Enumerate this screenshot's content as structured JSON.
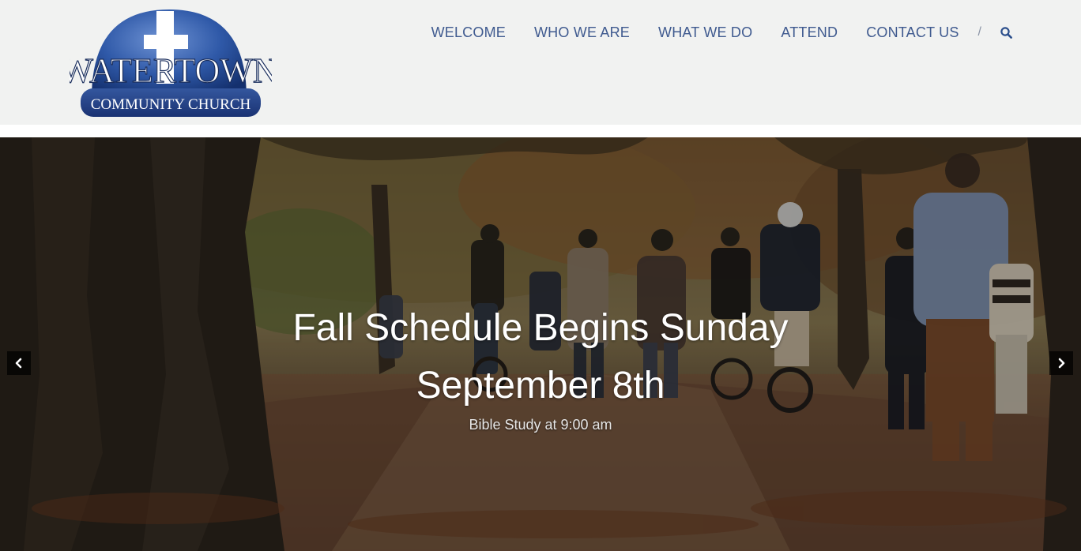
{
  "logo": {
    "name": "WATERTOWN",
    "subtitle": "COMMUNITY CHURCH"
  },
  "nav": {
    "items": [
      "WELCOME",
      "WHO WE ARE",
      "WHAT WE DO",
      "ATTEND",
      "CONTACT US"
    ],
    "separator": "/",
    "search_icon": "search-icon"
  },
  "hero": {
    "title": "Fall Schedule Begins Sunday September 8th",
    "subtitle": "Bible Study at 9:00 am",
    "prev_icon": "chevron-left-icon",
    "next_icon": "chevron-right-icon"
  },
  "colors": {
    "header_bg": "#f1f2f1",
    "nav_text": "#3f5a8f",
    "logo_blue": "#2b4d93",
    "arrow_bg": "#000000"
  }
}
